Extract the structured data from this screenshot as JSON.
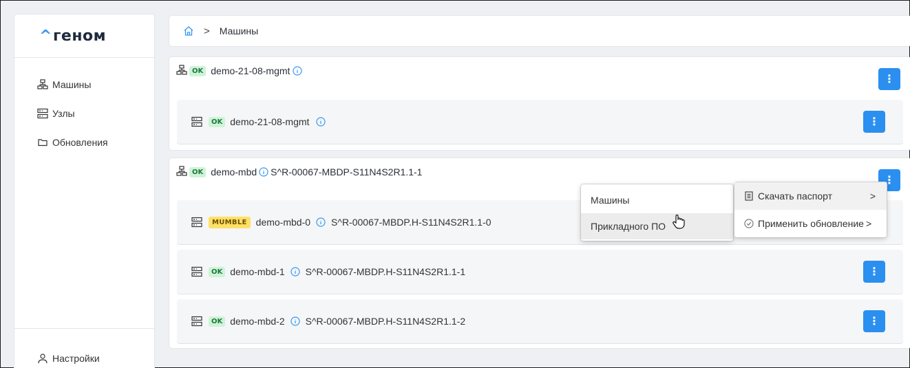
{
  "app": {
    "logo_caret": "^",
    "logo_text": "геном"
  },
  "sidebar": {
    "items": [
      {
        "label": "Машины",
        "icon": "machines-icon"
      },
      {
        "label": "Узлы",
        "icon": "server-icon"
      },
      {
        "label": "Обновления",
        "icon": "folder-icon"
      }
    ],
    "settings_label": "Настройки"
  },
  "breadcrumb": {
    "current": "Машины",
    "separator": ">"
  },
  "groups": [
    {
      "status": "OK",
      "name": "demo-21-08-mgmt",
      "serial": "",
      "nodes": [
        {
          "status": "OK",
          "name": "demo-21-08-mgmt",
          "serial": ""
        }
      ]
    },
    {
      "status": "OK",
      "name": "demo-mbd",
      "serial": "S^R-00067-MBDP-S11N4S2R1.1-1",
      "nodes": [
        {
          "status": "MUMBLE",
          "name": "demo-mbd-0",
          "serial": "S^R-00067-MBDP.H-S11N4S2R1.1-0"
        },
        {
          "status": "OK",
          "name": "demo-mbd-1",
          "serial": "S^R-00067-MBDP.H-S11N4S2R1.1-1"
        },
        {
          "status": "OK",
          "name": "demo-mbd-2",
          "serial": "S^R-00067-MBDP.H-S11N4S2R1.1-2"
        }
      ]
    }
  ],
  "kebab_label": "⋮",
  "context_menu": {
    "items": [
      {
        "label": "Скачать паспорт",
        "icon": "document-icon",
        "chevron": ">"
      },
      {
        "label": "Применить обновление",
        "icon": "check-circle-icon",
        "chevron": ">"
      }
    ]
  },
  "submenu": {
    "items": [
      {
        "label": "Машины"
      },
      {
        "label": "Прикладного ПО"
      }
    ]
  },
  "colors": {
    "accent": "#2b8ff0",
    "ok_bg": "#cff3d8",
    "mumble_bg": "#ffe066"
  }
}
